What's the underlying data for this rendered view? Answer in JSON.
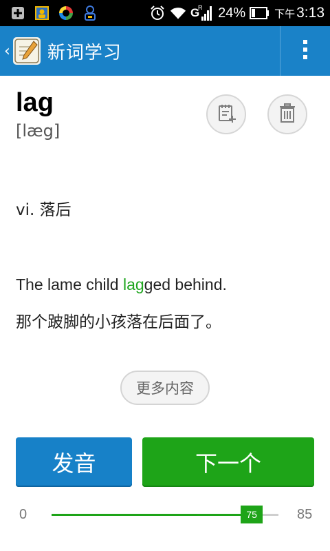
{
  "status_bar": {
    "left_icons": [
      "add-box-icon",
      "contact-card-icon",
      "sync-app-icon",
      "accessibility-icon"
    ],
    "right_icons": [
      "alarm-icon",
      "wifi-icon",
      "signal-g-icon",
      "battery-icon"
    ],
    "battery_percent": "24%",
    "time_prefix": "下午",
    "time": "3:13"
  },
  "action_bar": {
    "title": "新词学习",
    "app_icon": "wordbook-app-icon",
    "overflow_icon": "more-vertical-icon"
  },
  "word": {
    "headword": "lag",
    "phonetic": "[læg]"
  },
  "actions": {
    "note_icon": "add-to-notebook-icon",
    "delete_icon": "trash-icon"
  },
  "definition": "vi. 落后",
  "example": {
    "en_before": "The lame child ",
    "en_highlight": "lag",
    "en_after": "ged behind.",
    "zh": "那个跛脚的小孩落在后面了。"
  },
  "more_button": "更多内容",
  "buttons": {
    "speak": "发音",
    "next": "下一个"
  },
  "progress": {
    "min": "0",
    "max": "85",
    "current": "75",
    "current_value": 75,
    "max_value": 85
  },
  "colors": {
    "action_bar": "#1a82c8",
    "accent_green": "#1ea418",
    "speak_blue": "#1781c8"
  }
}
